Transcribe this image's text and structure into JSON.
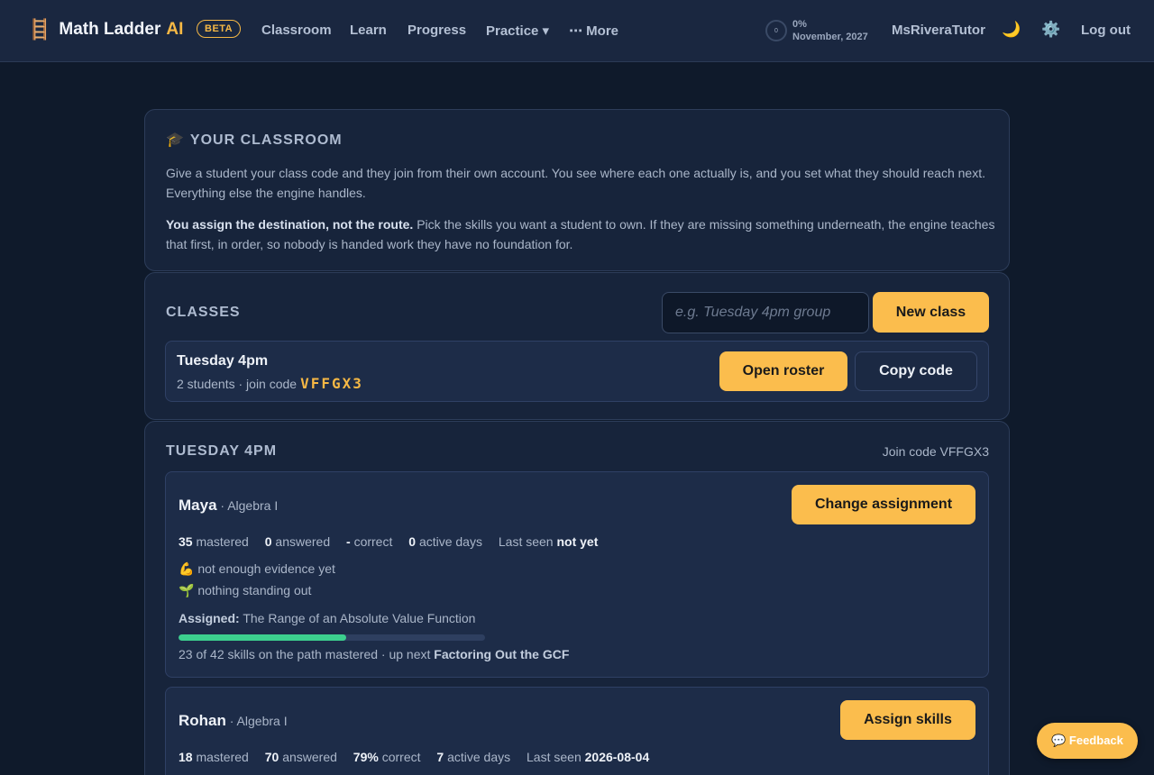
{
  "nav": {
    "brand_icon": "ladder-icon",
    "brand_name": "Math Ladder",
    "brand_ai": "AI",
    "beta": "BETA",
    "links": [
      "Classroom",
      "Learn",
      "Progress",
      "Practice ▾",
      "⋯ More"
    ],
    "progress_ring": "0",
    "progress_percent": "0%",
    "progress_date": "November, 2027",
    "username": "MsRiveraTutor",
    "logout": "Log out"
  },
  "intro": {
    "title": "YOUR CLASSROOM",
    "p1": "Give a student your class code and they join from their own account. You see where each one actually is, and you set what they should reach next. Everything else the engine handles.",
    "p2_bold": "You assign the destination, not the route.",
    "p2_rest": " Pick the skills you want a student to own. If they are missing something underneath, the engine teaches that first, in order, so nobody is handed work they have no foundation for."
  },
  "classes": {
    "title": "CLASSES",
    "input_placeholder": "e.g. Tuesday 4pm group",
    "new_class": "New class",
    "items": [
      {
        "name": "Tuesday 4pm",
        "meta": "2 students · join code",
        "code": "VFFGX3",
        "open_roster": "Open roster",
        "copy_code": "Copy code"
      }
    ]
  },
  "roster": {
    "title": "TUESDAY 4PM",
    "join_code": "Join code VFFGX3",
    "students": [
      {
        "name": "Maya",
        "level": " · Algebra I",
        "button": "Change assignment",
        "mastered": "35",
        "mastered_l": "mastered",
        "answered": "0",
        "answered_l": "answered",
        "correct": "-",
        "correct_l": "correct",
        "active": "0",
        "active_l": "active days",
        "last_seen_l": "Last seen",
        "last_seen": "not yet",
        "note1": "💪 not enough evidence yet",
        "note2": "🌱 nothing standing out",
        "assigned_l": "Assigned:",
        "assigned": " The Range of an Absolute Value Function",
        "progress_fraction": 0.548,
        "path_text": "23 of 42 skills on the path mastered · up next ",
        "up_next": "Factoring Out the GCF"
      },
      {
        "name": "Rohan",
        "level": " · Algebra I",
        "button": "Assign skills",
        "mastered": "18",
        "mastered_l": "mastered",
        "answered": "70",
        "answered_l": "answered",
        "correct": "79%",
        "correct_l": "correct",
        "active": "7",
        "active_l": "active days",
        "last_seen_l": "Last seen",
        "last_seen": "2026-08-04"
      }
    ]
  },
  "feedback": "💬 Feedback",
  "colors": {
    "accent": "#fbbd4d",
    "progress": "#3ccf8e",
    "background": "#0f1a2b"
  }
}
